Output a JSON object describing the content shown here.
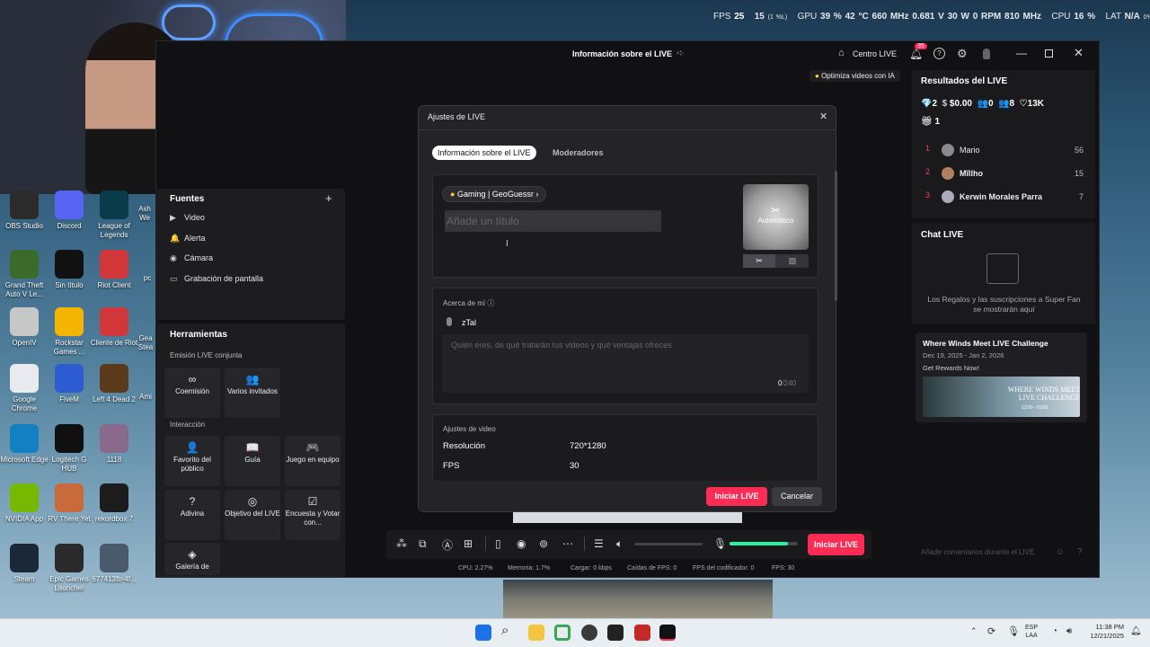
{
  "overlay": {
    "fps_label": "FPS",
    "fps": "25",
    "fps_low": "15",
    "fps_low_pct": "(1 %L)",
    "gpu_label": "GPU",
    "gpu_pct": "39 %",
    "gpu_temp": "42 °C",
    "gpu_clock": "660 MHz",
    "gpu_volt": "0.681 V",
    "gpu_power": "30 W",
    "gpu_fan": "0 RPM",
    "gpu_mem": "810 MHz",
    "cpu_label": "CPU",
    "cpu_pct": "16 %",
    "lat_label": "LAT",
    "lat": "N/A",
    "lat_unit": "0%"
  },
  "desktop_icons": [
    {
      "label": "OBS Studio",
      "color": "#2b2b2b"
    },
    {
      "label": "Discord",
      "color": "#5865f2"
    },
    {
      "label": "League of Legends",
      "color": "#0a3b4a"
    },
    {
      "label": "Grand Theft Auto V Le...",
      "color": "#3a6b2a"
    },
    {
      "label": "Sin título",
      "color": "#111"
    },
    {
      "label": "Riot Client",
      "color": "#d13639"
    },
    {
      "label": "OpenIV",
      "color": "#c7c7c7"
    },
    {
      "label": "Rockstar Games ...",
      "color": "#f4b400"
    },
    {
      "label": "Cliente de Riot",
      "color": "#d13639"
    },
    {
      "label": "Google Chrome",
      "color": "#e8eaed"
    },
    {
      "label": "FiveM",
      "color": "#2d5bd1"
    },
    {
      "label": "Left 4 Dead 2",
      "color": "#5a3a1a"
    },
    {
      "label": "Microsoft Edge",
      "color": "#1380c4"
    },
    {
      "label": "Logitech G HUB",
      "color": "#101010"
    },
    {
      "label": "1118",
      "color": "#8a6a8a"
    },
    {
      "label": "NVIDIA App",
      "color": "#76b900"
    },
    {
      "label": "RV There Yet",
      "color": "#c96a3a"
    },
    {
      "label": "rekordbox 7",
      "color": "#1c1c1c"
    },
    {
      "label": "Steam",
      "color": "#1b2838"
    },
    {
      "label": "Epic Games Launcher",
      "color": "#2a2a2a"
    },
    {
      "label": "677413fb-4f...",
      "color": "#4a5a6a"
    }
  ],
  "desktop_partial": [
    "Ash We",
    "pc",
    "Gea Stea",
    "Ami"
  ],
  "studio": {
    "header_title": "Información sobre el LIVE",
    "centro_live": "Centro LIVE",
    "notif_count": "35",
    "optimiza": "Optimiza videos con IA",
    "sources": {
      "title": "Fuentes",
      "add": "+",
      "items": [
        {
          "icon": "▶",
          "label": "Video"
        },
        {
          "icon": "🔔",
          "label": "Alerta"
        },
        {
          "icon": "◉",
          "label": "Cámara"
        },
        {
          "icon": "▭",
          "label": "Grabación de pantalla"
        }
      ]
    },
    "tools": {
      "title": "Herramientas",
      "section1": "Emisión LIVE conjunta",
      "s1_items": [
        {
          "icon": "∞",
          "label": "Coemisión"
        },
        {
          "icon": "👥",
          "label": "Varios invitados"
        }
      ],
      "section2": "Interacción",
      "s2_items": [
        {
          "icon": "👤",
          "label": "Favorito del público"
        },
        {
          "icon": "📖",
          "label": "Guía"
        },
        {
          "icon": "🎮",
          "label": "Juego en equipo"
        },
        {
          "icon": "?",
          "label": "Adivina"
        },
        {
          "icon": "◎",
          "label": "Objetivo del LIVE"
        },
        {
          "icon": "☑",
          "label": "Encuesta y Votar con..."
        },
        {
          "icon": "◈",
          "label": "Galería de"
        }
      ]
    },
    "results": {
      "title": "Resultados del LIVE",
      "stats": [
        {
          "icon": "💎",
          "value": "2"
        },
        {
          "icon": "$",
          "value": "$0.00"
        },
        {
          "icon": "👥",
          "value": "0"
        },
        {
          "icon": "👥",
          "value": "8"
        },
        {
          "icon": "♡",
          "value": "13K"
        }
      ],
      "gift": "1",
      "ranking": [
        {
          "rank": "1",
          "name": "Mario",
          "score": "56"
        },
        {
          "rank": "2",
          "name": "Mĩllho",
          "score": "15"
        },
        {
          "rank": "3",
          "name": "Kerwin Morales Parra",
          "score": "7"
        }
      ]
    },
    "chat": {
      "title": "Chat LIVE",
      "empty_text": "Los Regalos y las suscripciones a Super Fan se mostrarán aquí",
      "placeholder": "Añade comentarios durante el LIVE"
    },
    "promo": {
      "title": "Where Winds Meet LIVE Challenge",
      "dates": "Dec 19, 2025 - Jan 2, 2026",
      "cta": "Get Rewards Now!",
      "banner": "WHERE WINDS MEET LIVE CHALLENGE",
      "banner_dates": "12/20 - 01/02"
    },
    "bottom": {
      "start_live": "Iniciar LIVE",
      "volume_pct": 0,
      "mic_pct": 0.85
    },
    "status": {
      "cpu": "CPU: 2.27%",
      "memoria": "Memoria: 1.7%",
      "cargar": "Cargar: 0 kbps",
      "caidas": "Caídas de FPS: 0",
      "fps_codificador": "FPS del codificador: 0",
      "fps": "FPS: 30"
    }
  },
  "dialog": {
    "title": "Ajustes de LIVE",
    "tabs": [
      "Información sobre el LIVE",
      "Moderadores"
    ],
    "category": "Gaming | GeoGuessr",
    "title_placeholder": "Añade un título",
    "cover_label": "Automático",
    "about_title": "Acerca de mí",
    "username": "zTal",
    "about_placeholder": "Quién eres, de qué tratarán tus videos y qué ventajas ofreces",
    "char_count": "0",
    "char_max": "/240",
    "video_title": "Ajustes de video",
    "resolution_label": "Resolución",
    "resolution": "720*1280",
    "fps_label": "FPS",
    "fps": "30",
    "start": "Iniciar LIVE",
    "cancel": "Cancelar"
  },
  "taskbar": {
    "lang": "ESP",
    "lang2": "LAA",
    "time": "11:38 PM",
    "date": "12/21/2025"
  }
}
